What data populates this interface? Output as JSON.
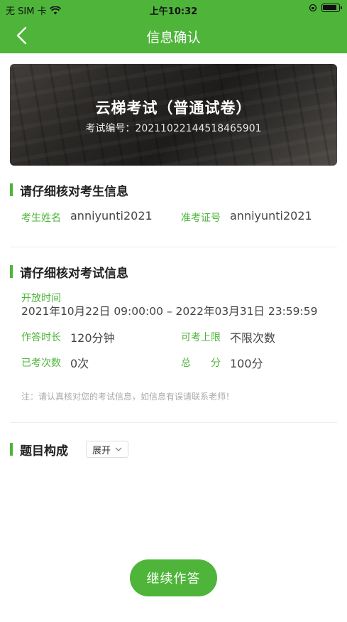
{
  "status_bar": {
    "carrier": "无 SIM 卡",
    "time": "上午10:32"
  },
  "nav": {
    "title": "信息确认",
    "back_icon": "chevron-left-icon"
  },
  "banner": {
    "title": "云梯考试（普通试卷）",
    "exam_no_label": "考试编号：",
    "exam_no": "20211022144518465901"
  },
  "candidate_section": {
    "title": "请仔细核对考生信息",
    "name_label": "考生姓名",
    "name_value": "anniyunti2021",
    "ticket_label": "准考证号",
    "ticket_value": "anniyunti2021"
  },
  "exam_section": {
    "title": "请仔细核对考试信息",
    "open_time_label": "开放时间",
    "open_time_value": "2021年10月22日 09:00:00 – 2022年03月31日 23:59:59",
    "duration_label": "作答时长",
    "duration_value": "120分钟",
    "max_attempts_label": "可考上限",
    "max_attempts_value": "不限次数",
    "taken_label": "已考次数",
    "taken_value": "0次",
    "total_label": "总　　分",
    "total_value": "100分",
    "note": "注：请认真核对您的考试信息，如信息有误请联系老师！"
  },
  "composition_section": {
    "title": "题目构成",
    "toggle_label": "展开"
  },
  "actions": {
    "continue_label": "继续作答"
  },
  "colors": {
    "primary": "#4eb53a",
    "label_green": "#4eb53a"
  }
}
